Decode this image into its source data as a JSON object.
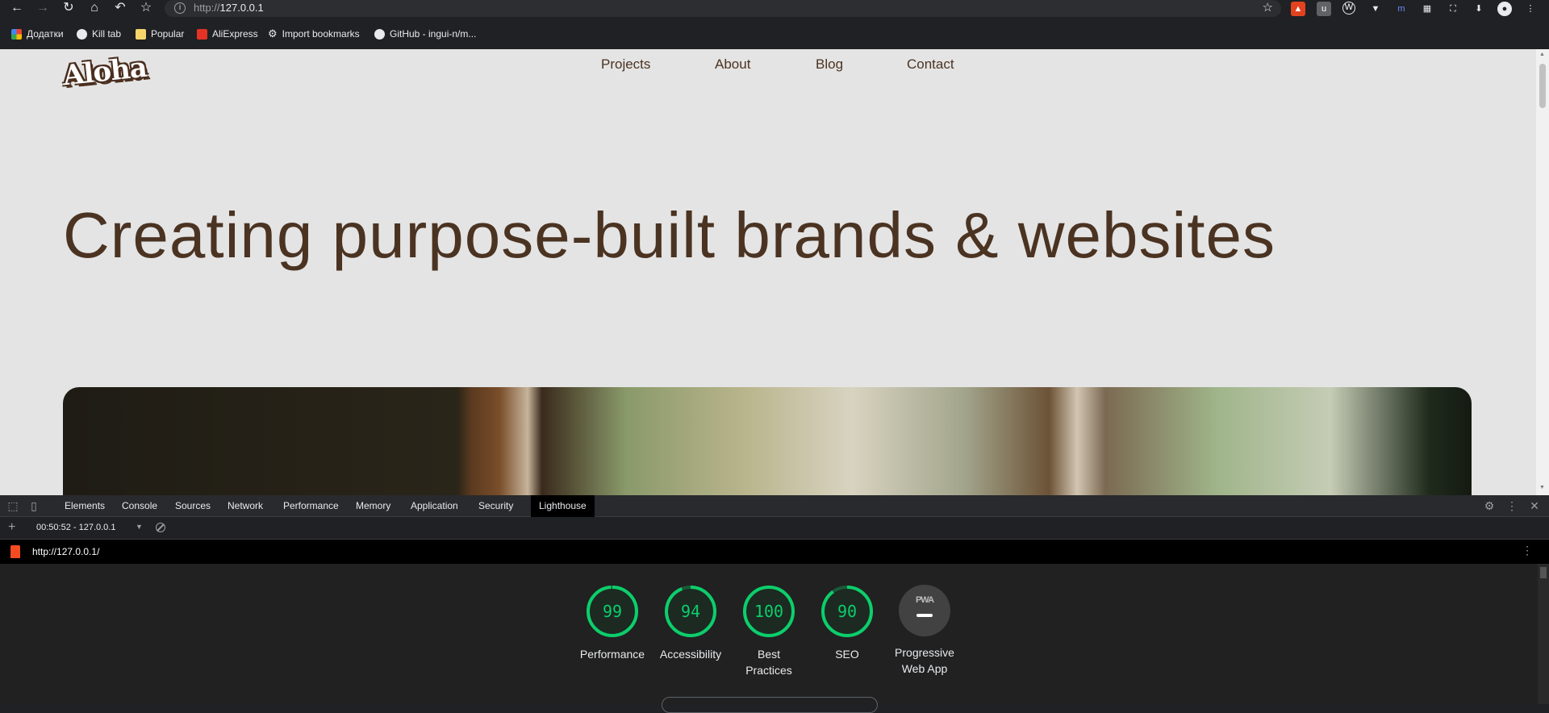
{
  "browser": {
    "url_prefix": "http://",
    "url_host": "127.0.0.1",
    "icons": [
      "back-icon",
      "forward-icon",
      "reload-icon",
      "home-icon",
      "undo-icon",
      "star-icon",
      "info-icon",
      "bookmark-star-icon"
    ]
  },
  "bookmarks": [
    {
      "label": "Додатки",
      "icon": "apps-grid-icon"
    },
    {
      "label": "Kill tab",
      "icon": "globe-icon"
    },
    {
      "label": "Popular",
      "icon": "folder-icon"
    },
    {
      "label": "AliExpress",
      "icon": "aliexpress-icon"
    },
    {
      "label": "Import bookmarks",
      "icon": "gear-icon"
    },
    {
      "label": "GitHub - ingui-n/m...",
      "icon": "github-icon"
    }
  ],
  "site": {
    "logo": "Aloha",
    "nav": [
      "Projects",
      "About",
      "Blog",
      "Contact"
    ],
    "hero_title": "Creating purpose-built brands & websites"
  },
  "devtools": {
    "tabs": [
      "Elements",
      "Console",
      "Sources",
      "Network",
      "Performance",
      "Memory",
      "Application",
      "Security",
      "Lighthouse"
    ],
    "active_tab": "Lighthouse",
    "report_select": "00:50:52 - 127.0.0.1",
    "report_url": "http://127.0.0.1/",
    "colors": {
      "pass": "#0cce6b",
      "track": "#1a5a38"
    },
    "scores": [
      {
        "value": "99",
        "score": 0.99,
        "label": "Performance"
      },
      {
        "value": "94",
        "score": 0.94,
        "label": "Accessibility"
      },
      {
        "value": "100",
        "score": 1.0,
        "label": "Best Practices"
      },
      {
        "value": "90",
        "score": 0.9,
        "label": "SEO"
      }
    ],
    "pwa": {
      "badge": "PWA",
      "label": "Progressive Web App"
    }
  }
}
